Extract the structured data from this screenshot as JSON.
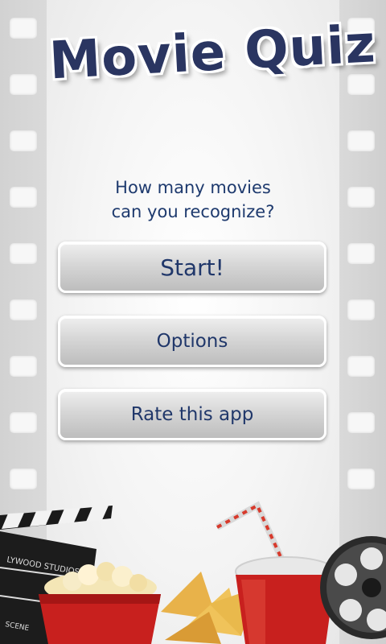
{
  "app": {
    "title": "Movie Quiz",
    "tagline_line1": "How many movies",
    "tagline_line2": "can you recognize?"
  },
  "menu": {
    "start_label": "Start!",
    "options_label": "Options",
    "rate_label": "Rate this app"
  },
  "decor": {
    "clapper_text_1": "LYWOOD STUDIOS",
    "clapper_text_2": "SCENE"
  },
  "colors": {
    "title": "#2a3561",
    "button_text": "#20376a",
    "accent_red": "#c8201e"
  }
}
